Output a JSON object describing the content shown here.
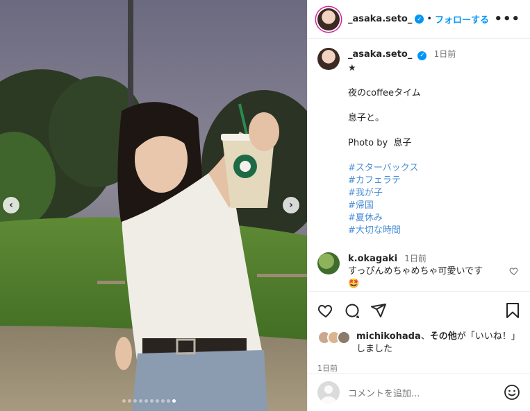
{
  "header": {
    "username": "_asaka.seto_",
    "separator": "•",
    "follow_label": "フォローする",
    "more_label": "•••"
  },
  "caption": {
    "username": "_asaka.seto_",
    "time": "1日前",
    "lines": [
      "★",
      "",
      "夜のcoffeeタイム",
      "",
      "息子と。",
      "",
      "Photo by  息子",
      ""
    ],
    "hashtags": [
      "#スターバックス",
      "#カフェラテ",
      "#我が子",
      "#帰国",
      "#夏休み",
      "#大切な時間"
    ]
  },
  "comment": {
    "username": "k.okagaki",
    "time": "1日前",
    "text": "すっぴんめちゃめちゃ可愛いです",
    "emoji": "🤩"
  },
  "likes": {
    "name": "michikohada",
    "middle": "、",
    "others": "その他",
    "suffix": "が「いいね！」しました"
  },
  "post_time": "1日前",
  "add_comment": {
    "placeholder": "コメントを追加..."
  },
  "carousel": {
    "prev_label": "‹",
    "next_label": "›",
    "slide_count": 10,
    "active_index": 9
  },
  "colors": {
    "accent": "#0095f6",
    "hashtag": "#4a8ed6",
    "secondary_text": "#737373"
  },
  "icons": [
    "heart-icon",
    "comment-icon",
    "share-icon",
    "bookmark-icon",
    "emoji-icon",
    "verified-icon",
    "more-icon"
  ]
}
